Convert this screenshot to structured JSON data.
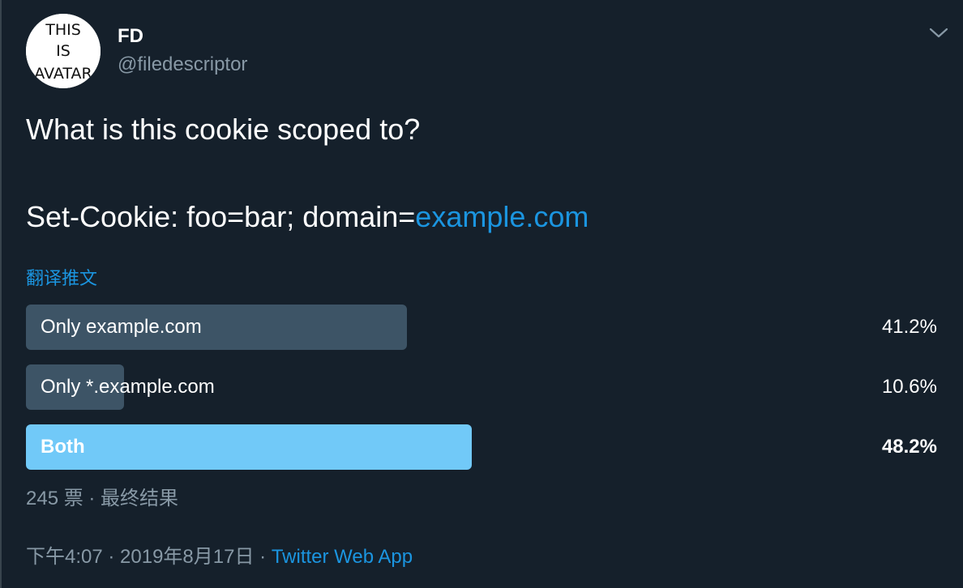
{
  "author": {
    "display_name": "FD",
    "handle": "@filedescriptor",
    "avatar_text": [
      "THIS",
      "IS",
      "AVATAR"
    ]
  },
  "tweet": {
    "line1": "What is this cookie scoped to?",
    "line2_prefix": "Set-Cookie: foo=bar; domain=",
    "line2_link": "example.com"
  },
  "translate_label": "翻译推文",
  "poll": {
    "options": [
      {
        "label": "Only example.com",
        "percent": "41.2%",
        "value": 41.2,
        "winner": false
      },
      {
        "label": "Only *.example.com",
        "percent": "10.6%",
        "value": 10.6,
        "winner": false
      },
      {
        "label": "Both",
        "percent": "48.2%",
        "value": 48.2,
        "winner": true
      }
    ],
    "meta": "245 票 · 最终结果"
  },
  "footer": {
    "time": "下午4:07 · 2019年8月17日",
    "separator": " · ",
    "app": "Twitter Web App"
  },
  "colors": {
    "background": "#15202b",
    "accent": "#1b95e0",
    "bar": "#3d5466",
    "winner_bar": "#71c9f8",
    "secondary_text": "#8899a6"
  },
  "icons": {
    "menu": "chevron-down-icon",
    "avatar": "avatar-image"
  }
}
